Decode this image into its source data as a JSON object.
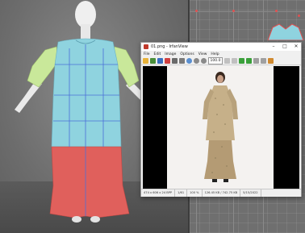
{
  "viewer": {
    "title": "01.png - IrfanView",
    "menu": [
      "File",
      "Edit",
      "Image",
      "Options",
      "View",
      "Help"
    ],
    "zoom": "100.0",
    "status": {
      "dimensions": "474 x 606 x 24 BPP",
      "index": "1/61",
      "zoom": "100 %",
      "filesize": "126.45 KB / 742.75 KB",
      "date": "5/15/2022"
    }
  },
  "colors": {
    "dress_top": "#8fd3df",
    "dress_bottom": "#e0605c",
    "sleeves": "#c9e89a",
    "avatar": "#eeeeee",
    "stitch_line": "#4a6fd8",
    "viewport_bg": "#6d6d6d",
    "photo_dress": "#c6b089"
  },
  "icons": {
    "app": "irfanview-icon",
    "minimize": "minimize-icon",
    "maximize": "maximize-icon",
    "close": "close-icon"
  },
  "window_controls": {
    "minimize": "–",
    "maximize": "□",
    "close": "✕"
  }
}
